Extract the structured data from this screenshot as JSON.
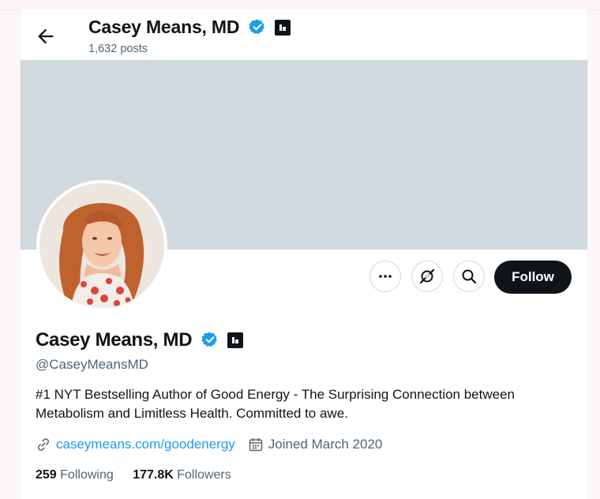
{
  "header": {
    "name": "Casey Means, MD",
    "posts_count": "1,632 posts"
  },
  "profile": {
    "name": "Casey Means, MD",
    "handle": "@CaseyMeansMD",
    "bio": "#1 NYT Bestselling Author of Good Energy - The Surprising Connection between Metabolism and Limitless Health. Committed to awe.",
    "website": "caseymeans.com/goodenergy",
    "joined": "Joined March 2020",
    "following_count": "259",
    "following_label": "Following",
    "followers_count": "177.8K",
    "followers_label": "Followers"
  },
  "actions": {
    "follow_label": "Follow"
  },
  "icons": {
    "back": "arrow-left-icon",
    "verified": "verified-badge-icon",
    "affiliate": "affiliate-badge-icon",
    "more": "more-dots-icon",
    "grok": "grok-icon",
    "search": "search-icon",
    "link": "link-icon",
    "calendar": "calendar-icon"
  },
  "colors": {
    "accent": "#1d9bf0",
    "banner": "#cfd9de",
    "text": "#0f1419",
    "secondary": "#536471",
    "follow_bg": "#0f1419"
  }
}
